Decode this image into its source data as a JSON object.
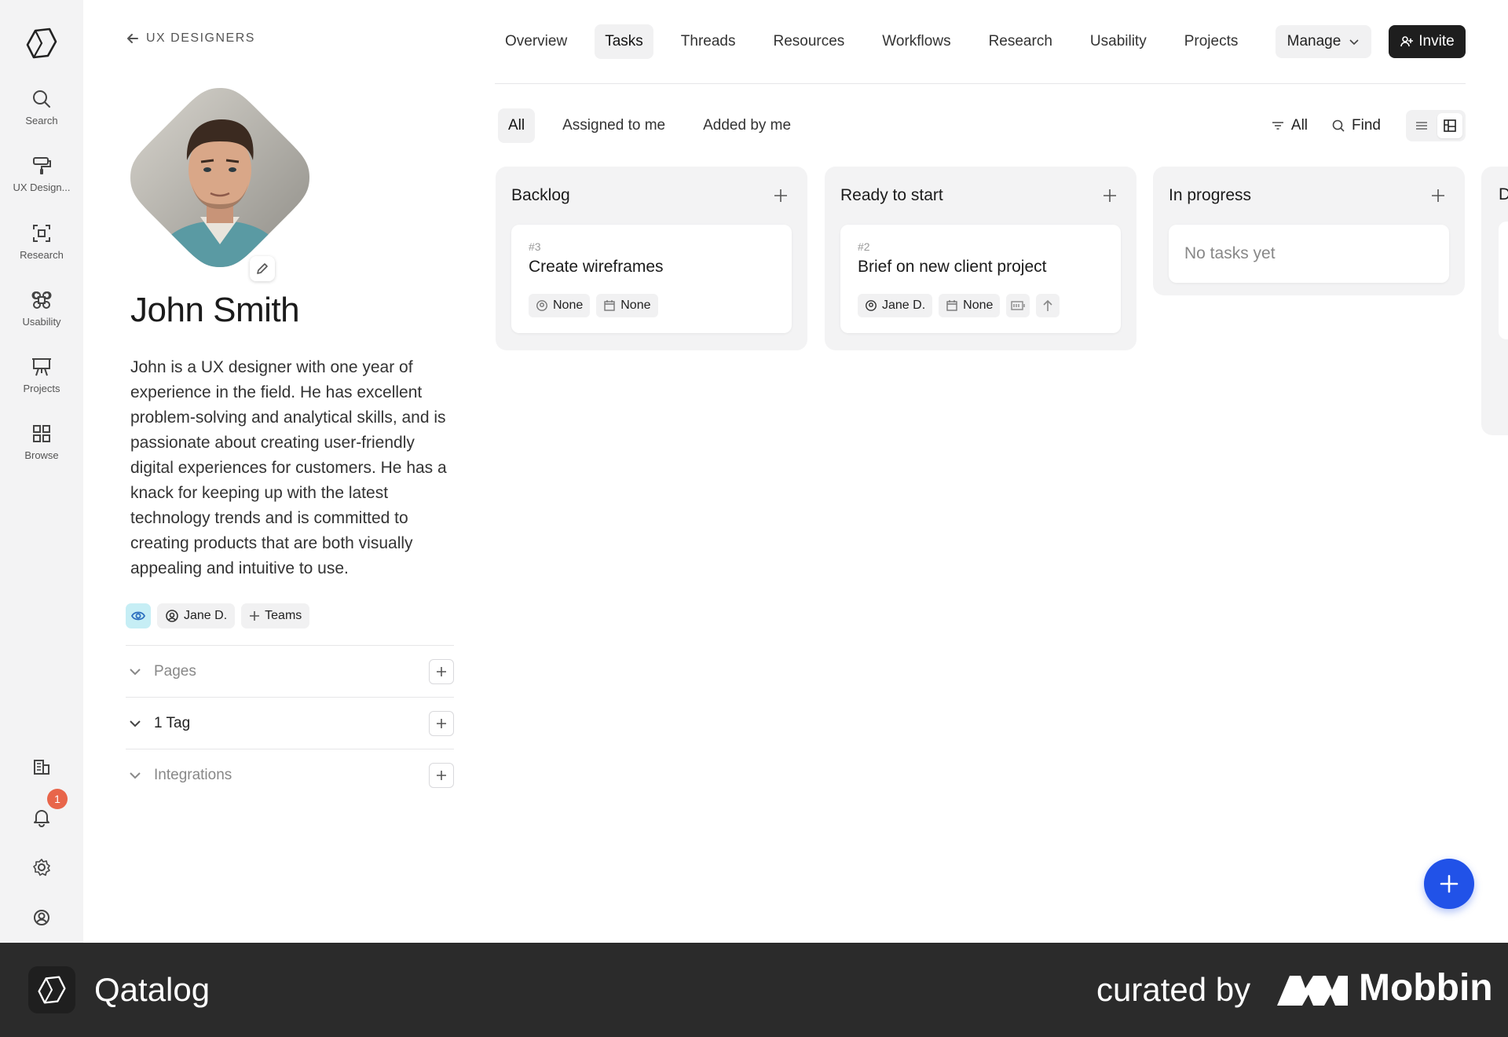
{
  "rail": {
    "items": [
      {
        "label": "Search",
        "icon": "search-icon"
      },
      {
        "label": "UX Design...",
        "icon": "paint-roller-icon"
      },
      {
        "label": "Research",
        "icon": "scan-icon"
      },
      {
        "label": "Usability",
        "icon": "command-icon"
      },
      {
        "label": "Projects",
        "icon": "easel-icon"
      },
      {
        "label": "Browse",
        "icon": "grid-icon"
      }
    ],
    "notification_count": "1"
  },
  "profile": {
    "back_label": "UX DESIGNERS",
    "name": "John Smith",
    "bio": "John is a UX designer with one year of experience in the field. He has excellent problem-solving and analytical skills, and is passionate about creating user-friendly digital experiences for customers. He has a knack for keeping up with the latest technology trends and is committed to creating products that are both visually appealing and intuitive to use.",
    "owner_chip": "Jane D.",
    "teams_chip": "Teams",
    "sections": [
      {
        "title": "Pages"
      },
      {
        "title": "1 Tag"
      },
      {
        "title": "Integrations"
      }
    ]
  },
  "nav": {
    "tabs": [
      "Overview",
      "Tasks",
      "Threads",
      "Resources",
      "Workflows",
      "Research",
      "Usability",
      "Projects"
    ],
    "active_tab": "Tasks",
    "manage_label": "Manage",
    "invite_label": "Invite"
  },
  "filters": {
    "tabs": [
      "All",
      "Assigned to me",
      "Added by me"
    ],
    "active": "All",
    "filter_label": "All",
    "find_label": "Find"
  },
  "board": {
    "columns": [
      {
        "title": "Backlog",
        "cards": [
          {
            "number": "#3",
            "title": "Create wireframes",
            "assignee": "None",
            "due": "None"
          }
        ]
      },
      {
        "title": "Ready to start",
        "cards": [
          {
            "number": "#2",
            "title": "Brief on new client project",
            "assignee": "Jane D.",
            "due": "None"
          }
        ]
      },
      {
        "title": "In progress",
        "empty_text": "No tasks yet"
      }
    ],
    "partial_column_title": "D"
  },
  "footer": {
    "app_name": "Qatalog",
    "curated_by": "curated by",
    "brand": "Mobbin"
  },
  "colors": {
    "accent": "#2152e8",
    "invite_bg": "#1e1e1e",
    "badge": "#e8654a",
    "rail_bg": "#f3f3f4",
    "eye_chip": "#c6eef5"
  }
}
